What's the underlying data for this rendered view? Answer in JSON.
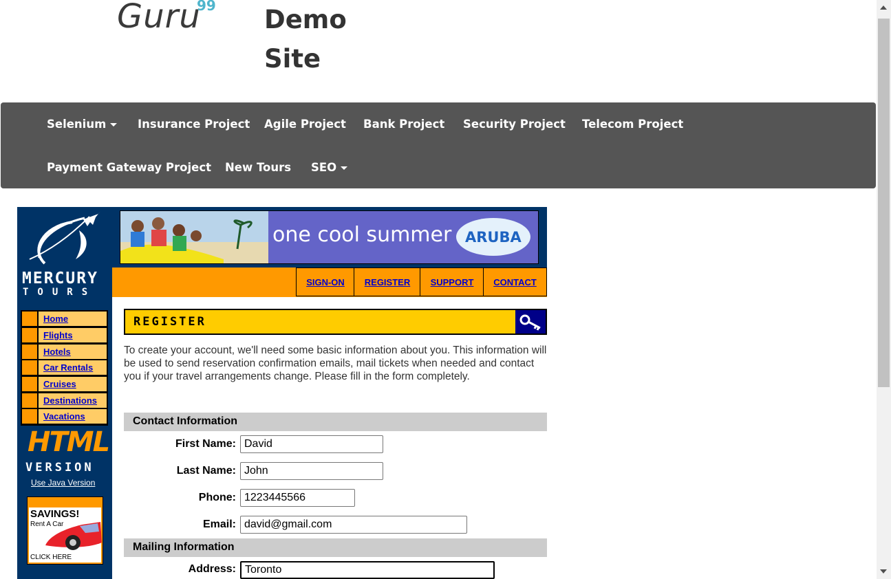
{
  "header": {
    "logo_text": "Guru",
    "logo_sup": "99",
    "site_title_line1": "Demo",
    "site_title_line2": "Site"
  },
  "navbar": {
    "items": [
      {
        "label": "Selenium",
        "dropdown": true
      },
      {
        "label": "Insurance Project"
      },
      {
        "label": "Agile Project"
      },
      {
        "label": "Bank Project"
      },
      {
        "label": "Security Project"
      },
      {
        "label": "Telecom Project"
      },
      {
        "label": "Payment Gateway Project"
      },
      {
        "label": "New Tours"
      },
      {
        "label": "SEO",
        "dropdown": true
      }
    ]
  },
  "mercury": {
    "brand": "MERCURY",
    "tours": "TOURS",
    "side_nav": [
      "Home",
      "Flights",
      "Hotels",
      "Car Rentals",
      "Cruises",
      "Destinations",
      "Vacations"
    ],
    "html_version": "HTML",
    "version": "VERSION",
    "java_link": "Use Java Version",
    "ad_title": "SAVINGS!",
    "ad_sub": "Rent A Car",
    "ad_click": "CLICK HERE"
  },
  "banner": {
    "text": "one cool summer",
    "brand": "ARUBA"
  },
  "top_links": [
    "SIGN-ON",
    "REGISTER",
    "SUPPORT",
    "CONTACT"
  ],
  "register": {
    "title": "REGISTER",
    "intro": "To create your account, we'll need some basic information about you. This information will be used to send reservation confirmation emails, mail tickets when needed and contact you if your travel arrangements change. Please fill in the form completely."
  },
  "form": {
    "contact_section": "Contact Information",
    "first_name_label": "First Name:",
    "first_name_value": "David",
    "last_name_label": "Last Name:",
    "last_name_value": "John",
    "phone_label": "Phone:",
    "phone_value": "1223445566",
    "email_label": "Email:",
    "email_value": "david@gmail.com",
    "mailing_section": "Mailing Information",
    "address_label": "Address:",
    "address_value": "Toronto"
  },
  "colors": {
    "navbar": "#555555",
    "mercury_blue": "#003366",
    "orange": "#ff9900",
    "register_yellow": "#ffcc00",
    "section_gray": "#cccccc",
    "link_blue": "#0000cc"
  },
  "icons": [
    "plane-logo-icon",
    "key-icon",
    "caret-down-icon",
    "car-icon"
  ]
}
